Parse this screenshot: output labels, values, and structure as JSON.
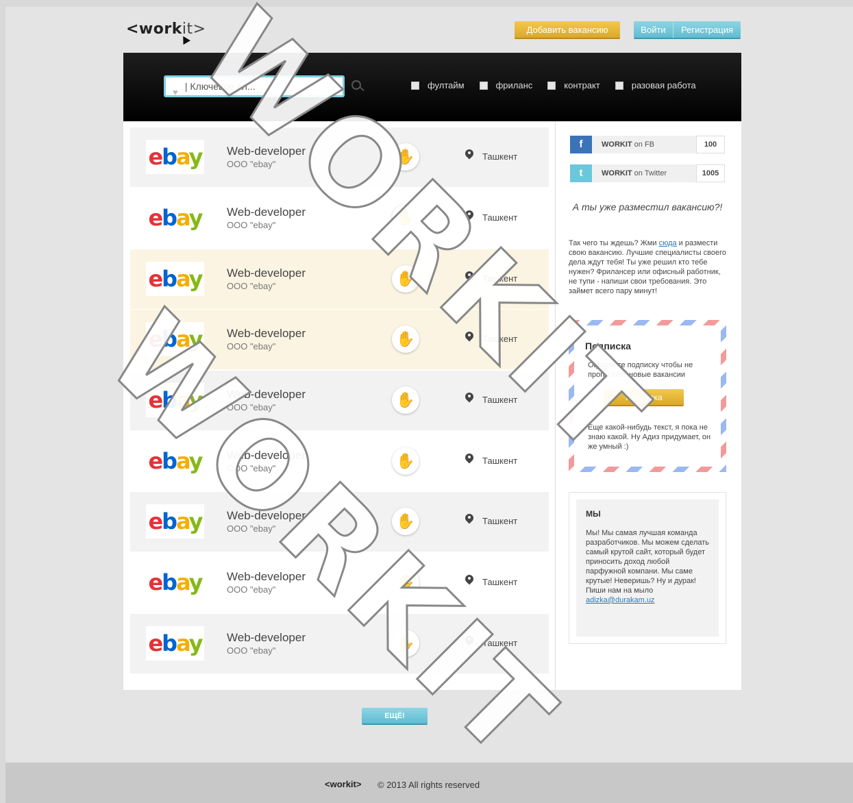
{
  "header": {
    "logo_bold": "<work",
    "logo_light": "it>",
    "add_vacancy_label": "Добавить вакансию",
    "login_label": "Войти",
    "register_label": "Регистрация"
  },
  "search": {
    "placeholder": "| Ключевое сл...",
    "filters": [
      "фултайм",
      "фриланс",
      "контракт",
      "разовая работа"
    ]
  },
  "jobs": [
    {
      "title": "Web-developer",
      "company": "OOO \"ebay\"",
      "city": "Ташкент",
      "logo": "ebay"
    },
    {
      "title": "Web-developer",
      "company": "OOO \"ebay\"",
      "city": "Ташкент",
      "logo": "ebay"
    },
    {
      "title": "Web-developer",
      "company": "OOO \"ebay\"",
      "city": "Ташкент",
      "logo": "ebay"
    },
    {
      "title": "Web-developer",
      "company": "OOO \"ebay\"",
      "city": "Ташкент",
      "logo": "ebay"
    },
    {
      "title": "Web-developer",
      "company": "OOO \"ebay\"",
      "city": "Ташкент",
      "logo": "ebay"
    },
    {
      "title": "Web-developer",
      "company": "OOO \"ebay\"",
      "city": "Ташкент",
      "logo": "ebay"
    },
    {
      "title": "Web-developer",
      "company": "OOO \"ebay\"",
      "city": "Ташкент",
      "logo": "ebay"
    },
    {
      "title": "Web-developer",
      "company": "OOO \"ebay\"",
      "city": "Ташкент",
      "logo": "ebay"
    },
    {
      "title": "Web-developer",
      "company": "OOO \"ebay\"",
      "city": "Ташкент",
      "logo": "ebay"
    }
  ],
  "sidebar": {
    "fb": {
      "brand": "WORKIT",
      "suffix": " on FB",
      "count": "100",
      "color": "#3b73b9"
    },
    "twitter": {
      "brand": "WORKIT",
      "suffix": " on Twitter",
      "count": "1005",
      "color": "#6cc7dc"
    },
    "promo_title": "А ты уже разместил вакансию?!",
    "promo_text_before": "Так чего ты ждешь? Жми ",
    "promo_link": "сюда",
    "promo_text_after": " и размести свою вакансию. Лучшие специалисты своего дела ждут тебя! Ты уже решил кто тебе нужен? Фрилансер или офисный работник, не тупи - напиши свои требования. Это займет всего пару минут!",
    "subscribe_title": "Подписка",
    "subscribe_text": "Оформите подписку чтобы не пропустить новые вакансии",
    "subscribe_button": "Подписка",
    "subscribe_note": "Еще какой-нибудь текст, я пока не знаю какой.  Ну Адиз придумает, он же умный :)",
    "about_title": "МЫ",
    "about_text": "Мы! Мы самая лучшая команда разработчиков. Мы можем сделать самый крутой сайт, который будет приносить доход любой парфужной компани. Мы саме крутые! Неверишь? Ну и дурак! Пиши нам на мыло",
    "about_email": "adizka@durakam.uz"
  },
  "more_button": "ЕЩЁ!",
  "footer": {
    "logo": "<workit>",
    "copyright": "© 2013 All rights reserved"
  },
  "watermark": "WORKIT",
  "colors": {
    "accent_yellow": "#dba82a",
    "accent_cyan": "#5fbcd1"
  }
}
